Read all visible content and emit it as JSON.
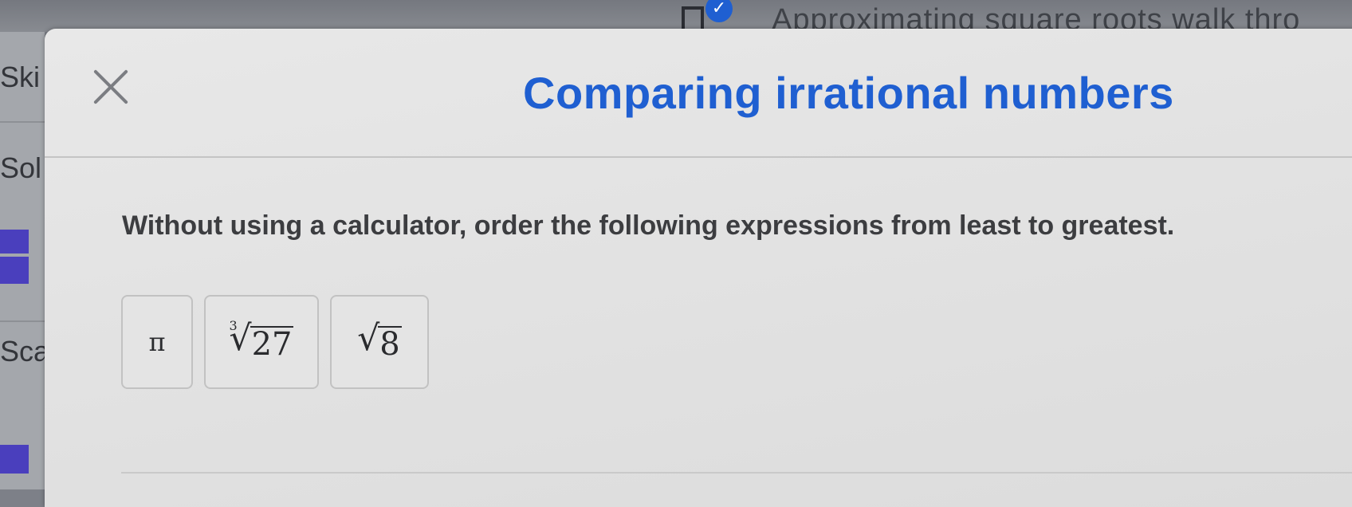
{
  "background": {
    "top_title": "Approximating square roots walk thro",
    "left_labels": [
      "Ski",
      "Sol",
      "Sca"
    ]
  },
  "modal": {
    "title": "Comparing irrational numbers",
    "close_icon": "close-icon",
    "prompt": "Without using a calculator, order the following expressions from least to greatest.",
    "tiles": [
      {
        "symbol": "π"
      },
      {
        "index": "3",
        "radicand": "27"
      },
      {
        "radicand": "8"
      }
    ]
  },
  "colors": {
    "accent": "#1f5fd1",
    "text": "#3c3d40",
    "sidebar_bar": "#4a3fbd"
  }
}
